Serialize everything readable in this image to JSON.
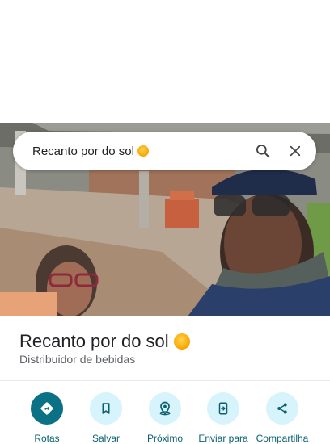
{
  "search": {
    "query": "Recanto por do sol"
  },
  "place": {
    "name": "Recanto por do sol",
    "category": "Distribuidor de bebidas"
  },
  "actions": [
    {
      "label": "Rotas",
      "icon": "directions-icon"
    },
    {
      "label": "Salvar",
      "icon": "bookmark-icon"
    },
    {
      "label": "Próximo",
      "icon": "nearby-icon"
    },
    {
      "label": "Enviar para",
      "icon": "send-to-phone-icon"
    },
    {
      "label": "Compartilha",
      "icon": "share-icon"
    }
  ],
  "colors": {
    "accent": "#0b7285",
    "chip": "#d7f3fb",
    "label": "#0b6172"
  }
}
